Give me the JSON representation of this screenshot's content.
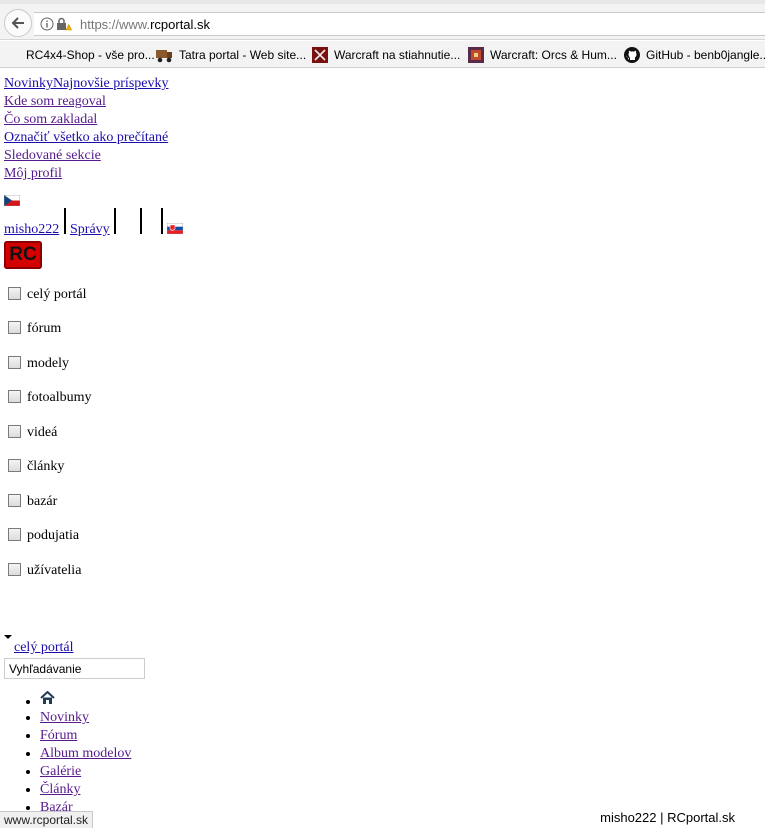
{
  "browser": {
    "url_protocol": "https://www.",
    "url_host": "rcportal.sk",
    "bookmarks": [
      {
        "label": "RC4x4-Shop - vše pro...",
        "icon": "rc4x4-favicon"
      },
      {
        "label": "Tatra portal - Web site...",
        "icon": "truck-favicon"
      },
      {
        "label": "Warcraft na stiahnutie...",
        "icon": "warcraft-favicon"
      },
      {
        "label": "Warcraft: Orcs & Hum...",
        "icon": "warcraft-game-favicon"
      },
      {
        "label": "GitHub - benb0jangle...",
        "icon": "github-icon"
      }
    ]
  },
  "menu": {
    "items": [
      "NovinkyNajnovšie príspevky",
      "Kde som reagoval",
      "Čo som zakladal",
      "Označiť všetko ako prečítané",
      "Sledované sekcie",
      "Môj profil"
    ]
  },
  "user": {
    "username": "misho222",
    "messages": "Správy"
  },
  "logo": {
    "text": "RC"
  },
  "filters": [
    "celý portál",
    "fórum",
    "modely",
    "fotoalbumy",
    "videá",
    "články",
    "bazár",
    "podujatia",
    "užívatelia"
  ],
  "search": {
    "scope": "celý portál",
    "placeholder": "Vyhľadávanie"
  },
  "nav": [
    "Novinky",
    "Fórum",
    "Album modelov",
    "Galérie",
    "Články",
    "Bazár"
  ],
  "status_url": "www.rcportal.sk",
  "footer": "misho222 | RCportal.sk",
  "colors": {
    "link": "#1a0dab",
    "visited": "#551a8b",
    "logo_red": "#d40000"
  }
}
